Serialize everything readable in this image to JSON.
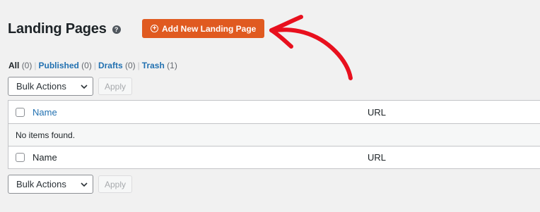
{
  "header": {
    "title": "Landing Pages",
    "help_glyph": "?",
    "add_button_label": "Add New Landing Page",
    "add_button_color": "#e05a20"
  },
  "filters": [
    {
      "label": "All",
      "count": "(0)",
      "current": true
    },
    {
      "label": "Published",
      "count": "(0)",
      "current": false
    },
    {
      "label": "Drafts",
      "count": "(0)",
      "current": false
    },
    {
      "label": "Trash",
      "count": "(1)",
      "current": false
    }
  ],
  "bulk_top": {
    "select_label": "Bulk Actions",
    "apply_label": "Apply"
  },
  "table": {
    "columns": {
      "name": "Name",
      "url": "URL"
    },
    "empty_message": "No items found.",
    "footer_columns": {
      "name": "Name",
      "url": "URL"
    }
  },
  "bulk_bottom": {
    "select_label": "Bulk Actions",
    "apply_label": "Apply"
  },
  "annotation": {
    "arrow_color": "#e8101e"
  },
  "icons": {
    "help": "help-icon",
    "add": "plus-circle-icon",
    "dropdown": "chevron-down-icon",
    "annotation": "hand-drawn-arrow"
  }
}
